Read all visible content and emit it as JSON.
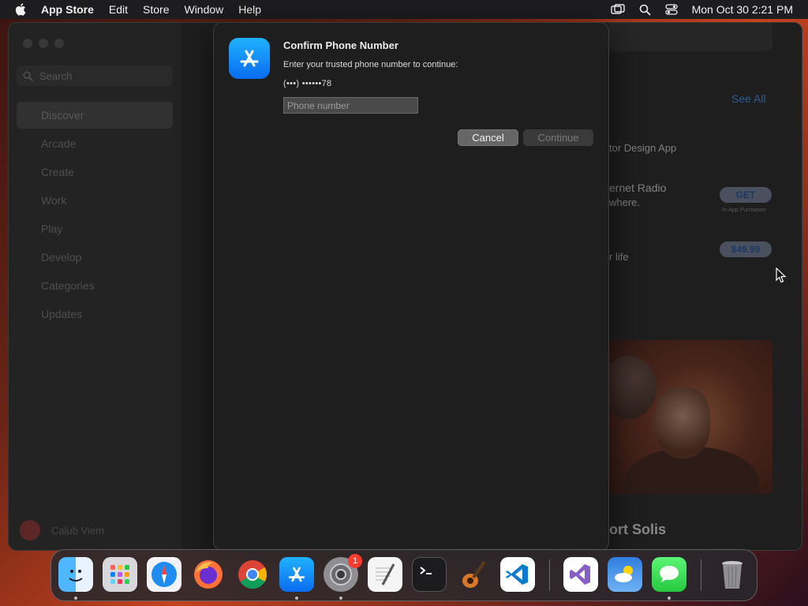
{
  "menubar": {
    "app_name": "App Store",
    "menus": [
      "Edit",
      "Store",
      "Window",
      "Help"
    ],
    "datetime": "Mon Oct 30  2:21 PM"
  },
  "sidebar": {
    "search_placeholder": "Search",
    "items": [
      {
        "label": "Discover",
        "active": true
      },
      {
        "label": "Arcade"
      },
      {
        "label": "Create"
      },
      {
        "label": "Work"
      },
      {
        "label": "Play"
      },
      {
        "label": "Develop"
      },
      {
        "label": "Categories"
      },
      {
        "label": "Updates"
      }
    ],
    "user_name": "Calub Viem"
  },
  "content": {
    "see_all": "See All",
    "row1_subtitle": "tor Design App",
    "row2_title": "ernet Radio",
    "row2_subtitle": "where.",
    "get_label": "GET",
    "get_note": "In-App Purchases",
    "row3_subtitle": "r life",
    "price_label": "$49.99",
    "feature_title": "ort Solis"
  },
  "dialog": {
    "title": "Confirm Phone Number",
    "message": "Enter your trusted phone number to continue:",
    "masked_number": "(•••) ••••••78",
    "input_placeholder": "Phone number",
    "input_value": "",
    "cancel_label": "Cancel",
    "continue_label": "Continue"
  },
  "dock": {
    "apps": [
      "finder-icon",
      "launchpad-icon",
      "safari-icon",
      "firefox-icon",
      "chrome-icon",
      "app-store-icon",
      "system-settings-icon",
      "textedit-icon",
      "terminal-icon",
      "garageband-icon",
      "vscode-icon",
      "visual-studio-icon",
      "weather-icon",
      "messages-icon",
      "trash-icon"
    ],
    "settings_badge": "1"
  },
  "colors": {
    "accent": "#0a84ff",
    "dialog_bg": "#1e1e1e",
    "badge": "#ff3b30"
  }
}
